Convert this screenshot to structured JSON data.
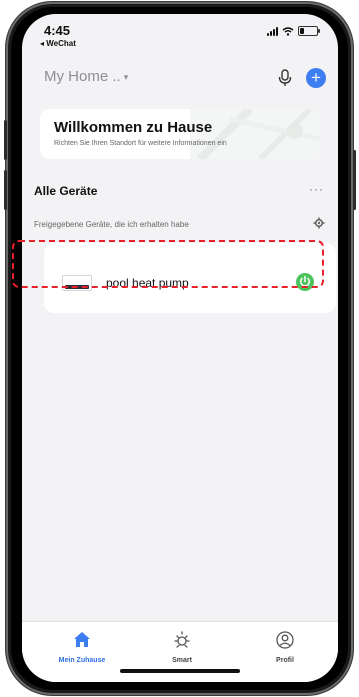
{
  "status_bar": {
    "time": "4:45",
    "back_app": "◂ WeChat"
  },
  "header": {
    "home_name": "My Home ..",
    "caret": "▾",
    "add": "+"
  },
  "welcome": {
    "title": "Willkommen zu Hause",
    "subtitle": "Richten Sie Ihren Standort für weitere Informationen ein"
  },
  "devices": {
    "section_title": "Alle Geräte",
    "more": "···",
    "shared_label": "Freigegebene Geräte, die ich erhalten habe",
    "items": [
      {
        "name": "pool heat pump",
        "power_on": true
      }
    ]
  },
  "tabbar": {
    "tabs": [
      {
        "label": "Mein Zuhause",
        "active": true
      },
      {
        "label": "Smart",
        "active": false
      },
      {
        "label": "Profil",
        "active": false
      }
    ]
  },
  "colors": {
    "accent": "#3c7ef2",
    "power_on": "#4cc35c",
    "highlight": "#e8202a"
  }
}
